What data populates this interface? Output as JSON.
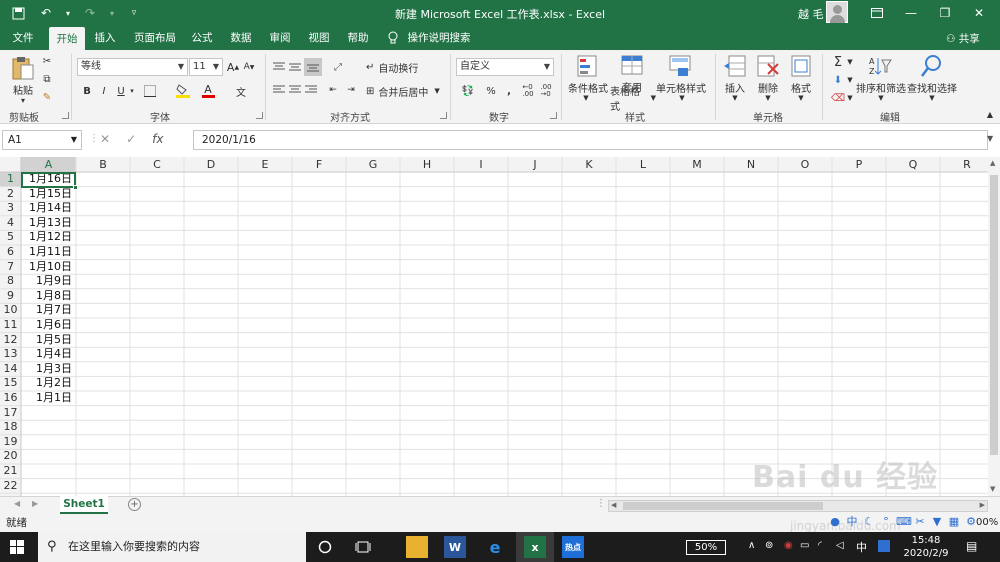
{
  "app": {
    "title": "新建 Microsoft Excel 工作表.xlsx  -  Excel",
    "user": "越 毛",
    "accent": "#217346"
  },
  "qat": {
    "save": "save-icon",
    "undo": "undo-icon",
    "redo": "redo-icon",
    "customize": "customize-icon"
  },
  "tabs": [
    {
      "label": "文件"
    },
    {
      "label": "开始"
    },
    {
      "label": "插入"
    },
    {
      "label": "页面布局"
    },
    {
      "label": "公式"
    },
    {
      "label": "数据"
    },
    {
      "label": "审阅"
    },
    {
      "label": "视图"
    },
    {
      "label": "帮助"
    },
    {
      "label": "操作说明搜索"
    }
  ],
  "share": "共享",
  "ribbon": {
    "clipboard": {
      "paste": "粘贴",
      "label": "剪贴板"
    },
    "font": {
      "name": "等线",
      "size": "11",
      "grow": "A",
      "shrink": "A",
      "bold": "B",
      "italic": "I",
      "underline": "U",
      "color_a": "A",
      "wen": "文",
      "label": "字体"
    },
    "alignment": {
      "wrap": "自动换行",
      "merge": "合并后居中",
      "label": "对齐方式"
    },
    "number": {
      "format": "自定义",
      "percent": "%",
      "comma": ",",
      "inc": ".0→.00",
      "dec": ".00→.0",
      "label": "数字"
    },
    "styles": {
      "conditional": "条件格式",
      "table_a": "套用",
      "table_b": "表格格式",
      "cell_styles": "单元格样式",
      "label": "样式"
    },
    "cells": {
      "insert": "插入",
      "delete": "删除",
      "format": "格式",
      "label": "单元格"
    },
    "editing": {
      "sigma": "Σ",
      "sort": "排序和筛选",
      "find": "查找和选择",
      "label": "编辑"
    }
  },
  "formula_bar": {
    "name_box": "A1",
    "fx": "fx",
    "value": "2020/1/16"
  },
  "columns": [
    "A",
    "B",
    "C",
    "D",
    "E",
    "F",
    "G",
    "H",
    "I",
    "J",
    "K",
    "L",
    "M",
    "N",
    "O",
    "P",
    "Q",
    "R"
  ],
  "rows": [
    "1",
    "2",
    "3",
    "4",
    "5",
    "6",
    "7",
    "8",
    "9",
    "10",
    "11",
    "12",
    "13",
    "14",
    "15",
    "16",
    "17",
    "18",
    "19",
    "20",
    "21",
    "22"
  ],
  "cells_a": [
    "1月16日",
    "1月15日",
    "1月14日",
    "1月13日",
    "1月12日",
    "1月11日",
    "1月10日",
    "1月9日",
    "1月8日",
    "1月7日",
    "1月6日",
    "1月5日",
    "1月4日",
    "1月3日",
    "1月2日",
    "1月1日"
  ],
  "sheet": {
    "tab": "Sheet1",
    "add": "+"
  },
  "status": {
    "ready": "就绪",
    "zoom": "00%"
  },
  "taskbar": {
    "search_placeholder": "在这里输入你要搜索的内容",
    "battery": "50%",
    "ime": "中",
    "time": "15:48",
    "date": "2020/2/9"
  },
  "watermark": {
    "text": "Bai du 经验",
    "url": "jingyan.baidu.com"
  }
}
